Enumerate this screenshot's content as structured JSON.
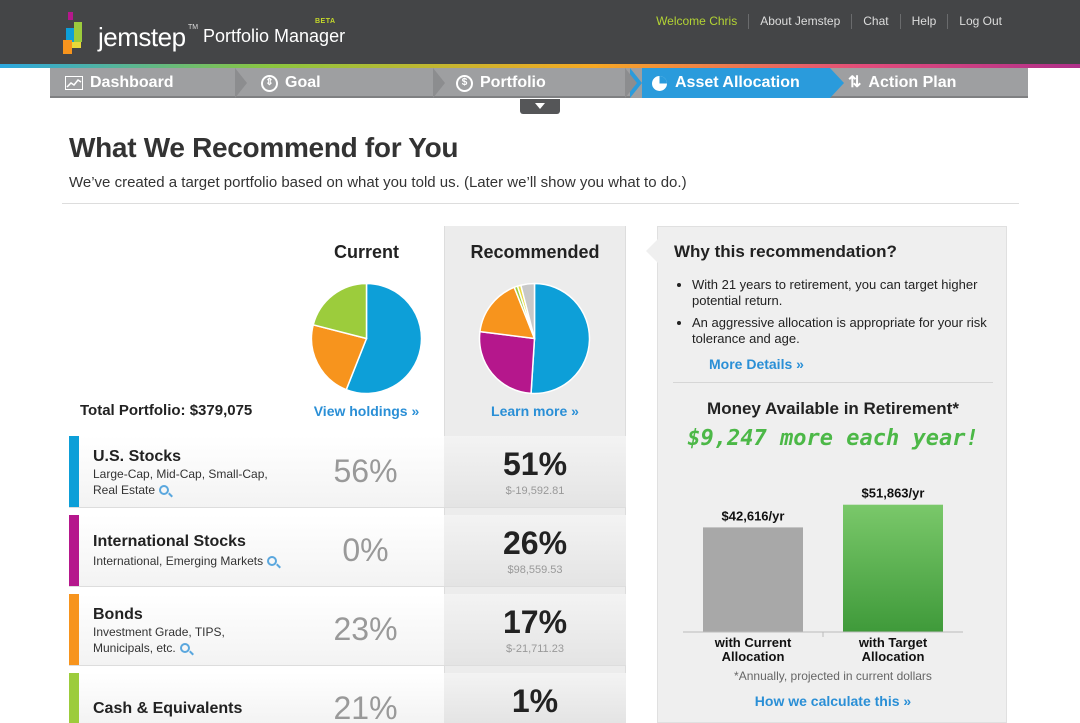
{
  "header": {
    "logo_text": "jemstep",
    "logo_tm": "TM",
    "product": "Portfolio Manager",
    "beta": "BETA",
    "nav": [
      "Welcome Chris",
      "About Jemstep",
      "Chat",
      "Help",
      "Log Out"
    ]
  },
  "steps": [
    {
      "label": "Dashboard",
      "icon": "chart-icon"
    },
    {
      "label": "Goal",
      "icon": "goal-icon"
    },
    {
      "label": "Portfolio",
      "icon": "dollar-icon"
    },
    {
      "label": "Asset Allocation",
      "icon": "pie-icon",
      "active": true
    },
    {
      "label": "Action Plan",
      "icon": "arrows-icon"
    }
  ],
  "page": {
    "title": "What We Recommend for You",
    "subtitle": "We’ve created a target portfolio based on what you told us. (Later we’ll show you what to do.)"
  },
  "columns": {
    "current_head": "Current",
    "recommended_head": "Recommended",
    "current_link": "View holdings »",
    "recommended_link": "Learn more »",
    "total": "Total Portfolio: $379,075"
  },
  "colors": {
    "us_stocks": "#0d9fd8",
    "intl_stocks": "#b5178c",
    "bonds": "#f7941d",
    "cash": "#9ccc3c",
    "other_grey": "#c8c8c8",
    "other_yellow": "#e8d83a",
    "accent_blue": "#2a8fd6",
    "gain_green": "#4cb847"
  },
  "current_allocation": [
    {
      "name": "U.S. Stocks",
      "value": 56
    },
    {
      "name": "Bonds",
      "value": 23
    },
    {
      "name": "Cash & Equivalents",
      "value": 21
    }
  ],
  "recommended_allocation": [
    {
      "name": "U.S. Stocks",
      "value": 51
    },
    {
      "name": "International Stocks",
      "value": 26
    },
    {
      "name": "Bonds",
      "value": 17
    },
    {
      "name": "Cash & Equivalents",
      "value": 1
    },
    {
      "name": "Other",
      "value": 1
    },
    {
      "name": "Other",
      "value": 4
    }
  ],
  "rows": [
    {
      "name": "U.S. Stocks",
      "desc": "Large-Cap, Mid-Cap, Small-Cap, Real Estate",
      "current": "56%",
      "recommended": "51%",
      "delta": "$-19,592.81"
    },
    {
      "name": "International Stocks",
      "desc": "International, Emerging Markets",
      "current": "0%",
      "recommended": "26%",
      "delta": "$98,559.53"
    },
    {
      "name": "Bonds",
      "desc": "Investment Grade, TIPS, Municipals, etc.",
      "current": "23%",
      "recommended": "17%",
      "delta": "$-21,711.23"
    },
    {
      "name": "Cash & Equivalents",
      "desc": "",
      "current": "21%",
      "recommended": "1%",
      "delta": ""
    }
  ],
  "why": {
    "title": "Why this recommendation?",
    "bullets": [
      "With 21 years to retirement, you can target higher potential return.",
      "An aggressive allocation is appropriate for your risk tolerance and age."
    ],
    "more": "More Details »"
  },
  "money": {
    "title": "Money Available in Retirement*",
    "gain": "$9,247 more each year!",
    "footnote": "*Annually, projected in current dollars",
    "calc_link": "How we calculate this »"
  },
  "chart_data": {
    "type": "bar",
    "categories": [
      "with Current Allocation",
      "with Target Allocation"
    ],
    "values": [
      42616,
      51863
    ],
    "value_labels": [
      "$42,616/yr",
      "$51,863/yr"
    ],
    "title": "Money Available in Retirement*",
    "xlabel": "",
    "ylabel": "",
    "ylim": [
      0,
      55000
    ],
    "grid": false
  }
}
